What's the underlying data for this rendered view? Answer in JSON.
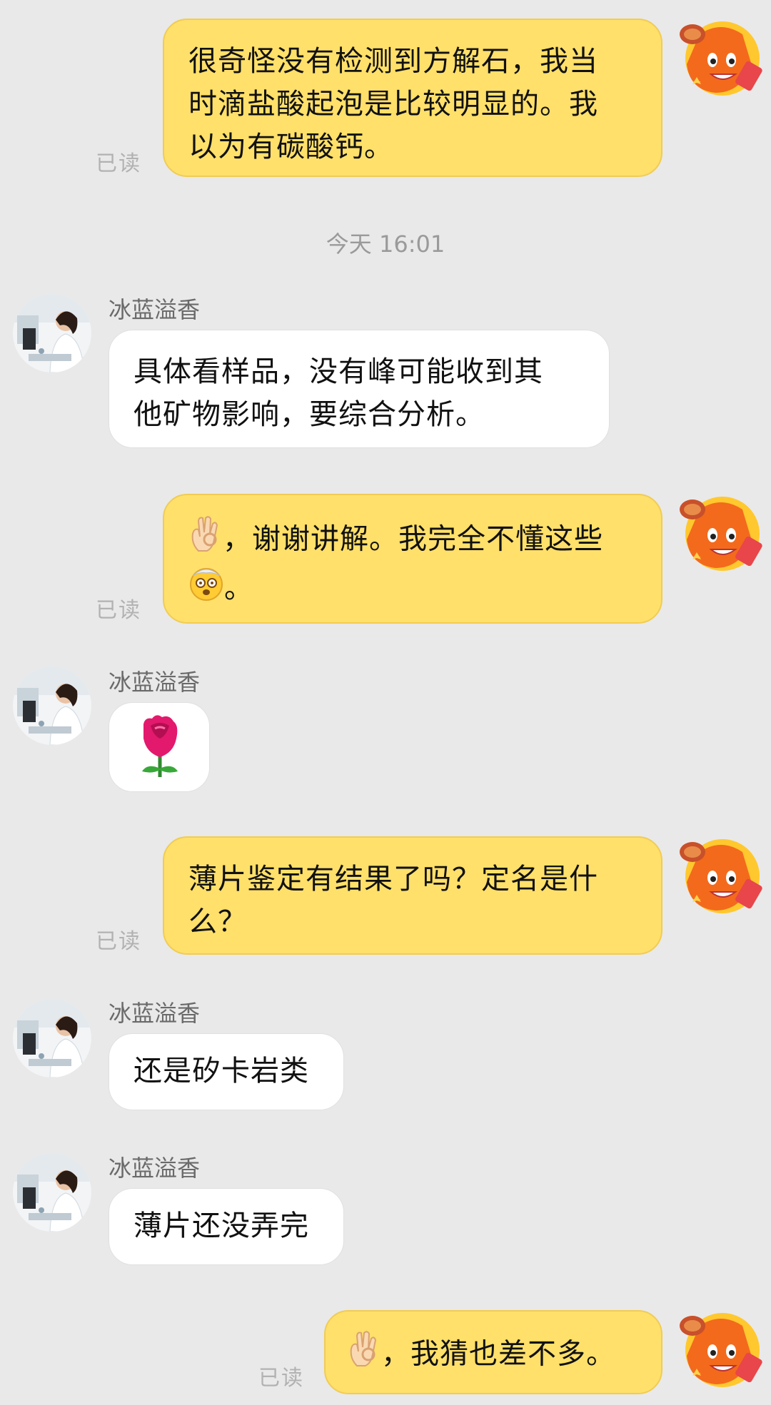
{
  "contact": {
    "name": "冰蓝溢香"
  },
  "timestamp": "今天  16:01",
  "read_label": "已读",
  "messages": [
    {
      "id": "m1",
      "side": "out",
      "text": "很奇怪没有检测到方解石，我当时滴盐酸起泡是比较明显的。我以为有碳酸钙。",
      "lines": [
        "很奇怪没有检测到方解石，我当",
        "时滴盐酸起泡是比较明显的。我",
        "以为有碳酸钙。"
      ],
      "status": "已读"
    },
    {
      "id": "m2",
      "side": "in",
      "sender": "冰蓝溢香",
      "lines": [
        "具体看样品，没有峰可能收到其",
        "他矿物影响，要综合分析。"
      ]
    },
    {
      "id": "m3",
      "side": "out",
      "line1_text": "，谢谢讲解。我完全不懂这些",
      "line2_text": "。",
      "emoji1": "ok-hand-emoji",
      "emoji2": "dizzy-face-emoji",
      "status": "已读"
    },
    {
      "id": "m4",
      "side": "in",
      "sender": "冰蓝溢香",
      "emoji": "rose-emoji"
    },
    {
      "id": "m5",
      "side": "out",
      "lines": [
        "薄片鉴定有结果了吗？定名是什",
        "么？"
      ],
      "status": "已读"
    },
    {
      "id": "m6",
      "side": "in",
      "sender": "冰蓝溢香",
      "text": "还是矽卡岩类"
    },
    {
      "id": "m7",
      "side": "in",
      "sender": "冰蓝溢香",
      "text": "薄片还没弄完"
    },
    {
      "id": "m8",
      "side": "out",
      "text": "，我猜也差不多。",
      "emoji1": "ok-hand-emoji",
      "status": "已读"
    }
  ],
  "colors": {
    "background": "#e9e9e9",
    "outgoing_bubble": "#ffe06a",
    "incoming_bubble": "#ffffff",
    "read_text": "#b2b2b2"
  }
}
